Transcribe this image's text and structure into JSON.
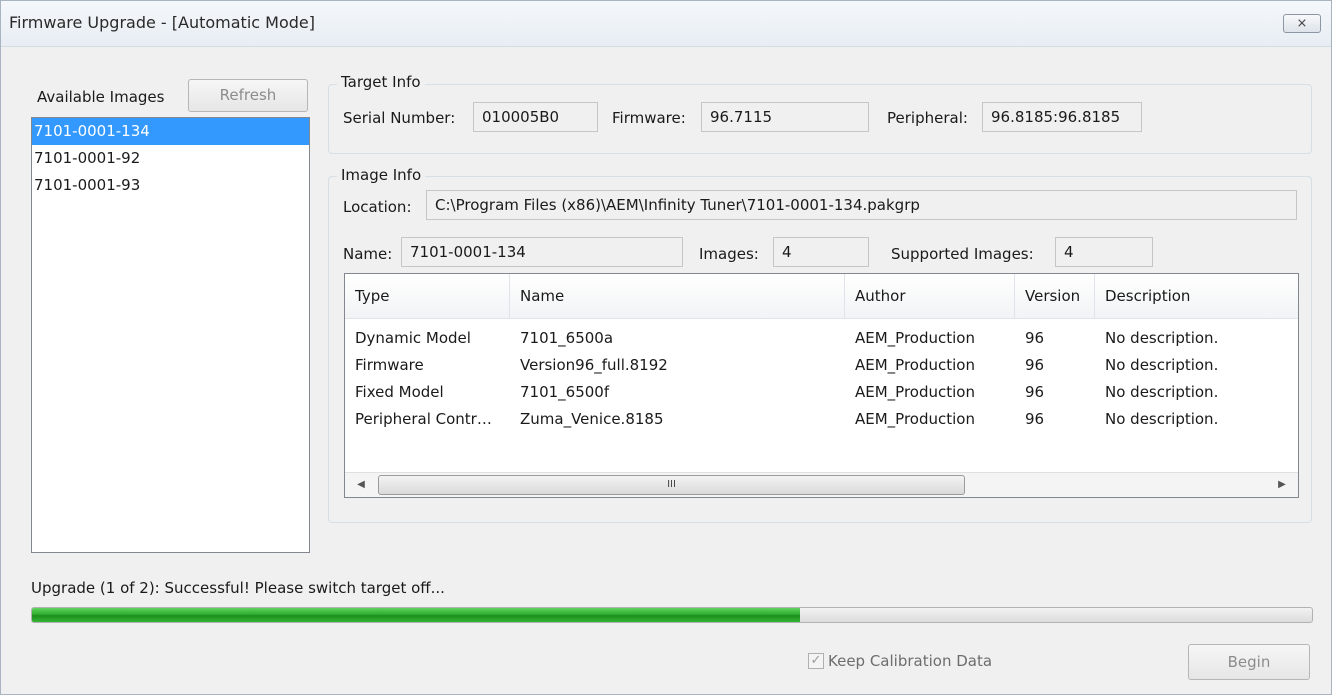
{
  "window": {
    "title": "Firmware Upgrade - [Automatic Mode]",
    "close_icon": "close-icon",
    "close_glyph": "⨯"
  },
  "images_panel": {
    "label": "Available Images",
    "refresh_label": "Refresh",
    "items": [
      "7101-0001-134",
      "7101-0001-92",
      "7101-0001-93"
    ],
    "selected_index": 0
  },
  "target_info": {
    "title": "Target Info",
    "serial_label": "Serial Number:",
    "serial_value": "010005B0",
    "firmware_label": "Firmware:",
    "firmware_value": "96.7115",
    "peripheral_label": "Peripheral:",
    "peripheral_value": "96.8185:96.8185"
  },
  "image_info": {
    "title": "Image Info",
    "location_label": "Location:",
    "location_value": "C:\\Program Files (x86)\\AEM\\Infinity Tuner\\7101-0001-134.pakgrp",
    "name_label": "Name:",
    "name_value": "7101-0001-134",
    "images_label": "Images:",
    "images_value": "4",
    "supported_label": "Supported Images:",
    "supported_value": "4"
  },
  "table": {
    "columns": [
      "Type",
      "Name",
      "Author",
      "Version",
      "Description"
    ],
    "rows": [
      [
        "Dynamic Model",
        "7101_6500a",
        "AEM_Production",
        "96",
        "No description."
      ],
      [
        "Firmware",
        "Version96_full.8192",
        "AEM_Production",
        "96",
        "No description."
      ],
      [
        "Fixed Model",
        "7101_6500f",
        "AEM_Production",
        "96",
        "No description."
      ],
      [
        "Peripheral Contr…",
        "Zuma_Venice.8185",
        "AEM_Production",
        "96",
        "No description."
      ]
    ],
    "scroll_left_glyph": "◀",
    "scroll_right_glyph": "▶",
    "thumb_grip": "III"
  },
  "status": {
    "text": "Upgrade (1 of 2): Successful!  Please switch target off...",
    "progress_fraction": 0.6,
    "progress_color": "#2fae2f"
  },
  "footer": {
    "keep_calibration_label": "Keep Calibration Data",
    "keep_calibration_checked": true,
    "check_glyph": "✓",
    "begin_label": "Begin"
  }
}
